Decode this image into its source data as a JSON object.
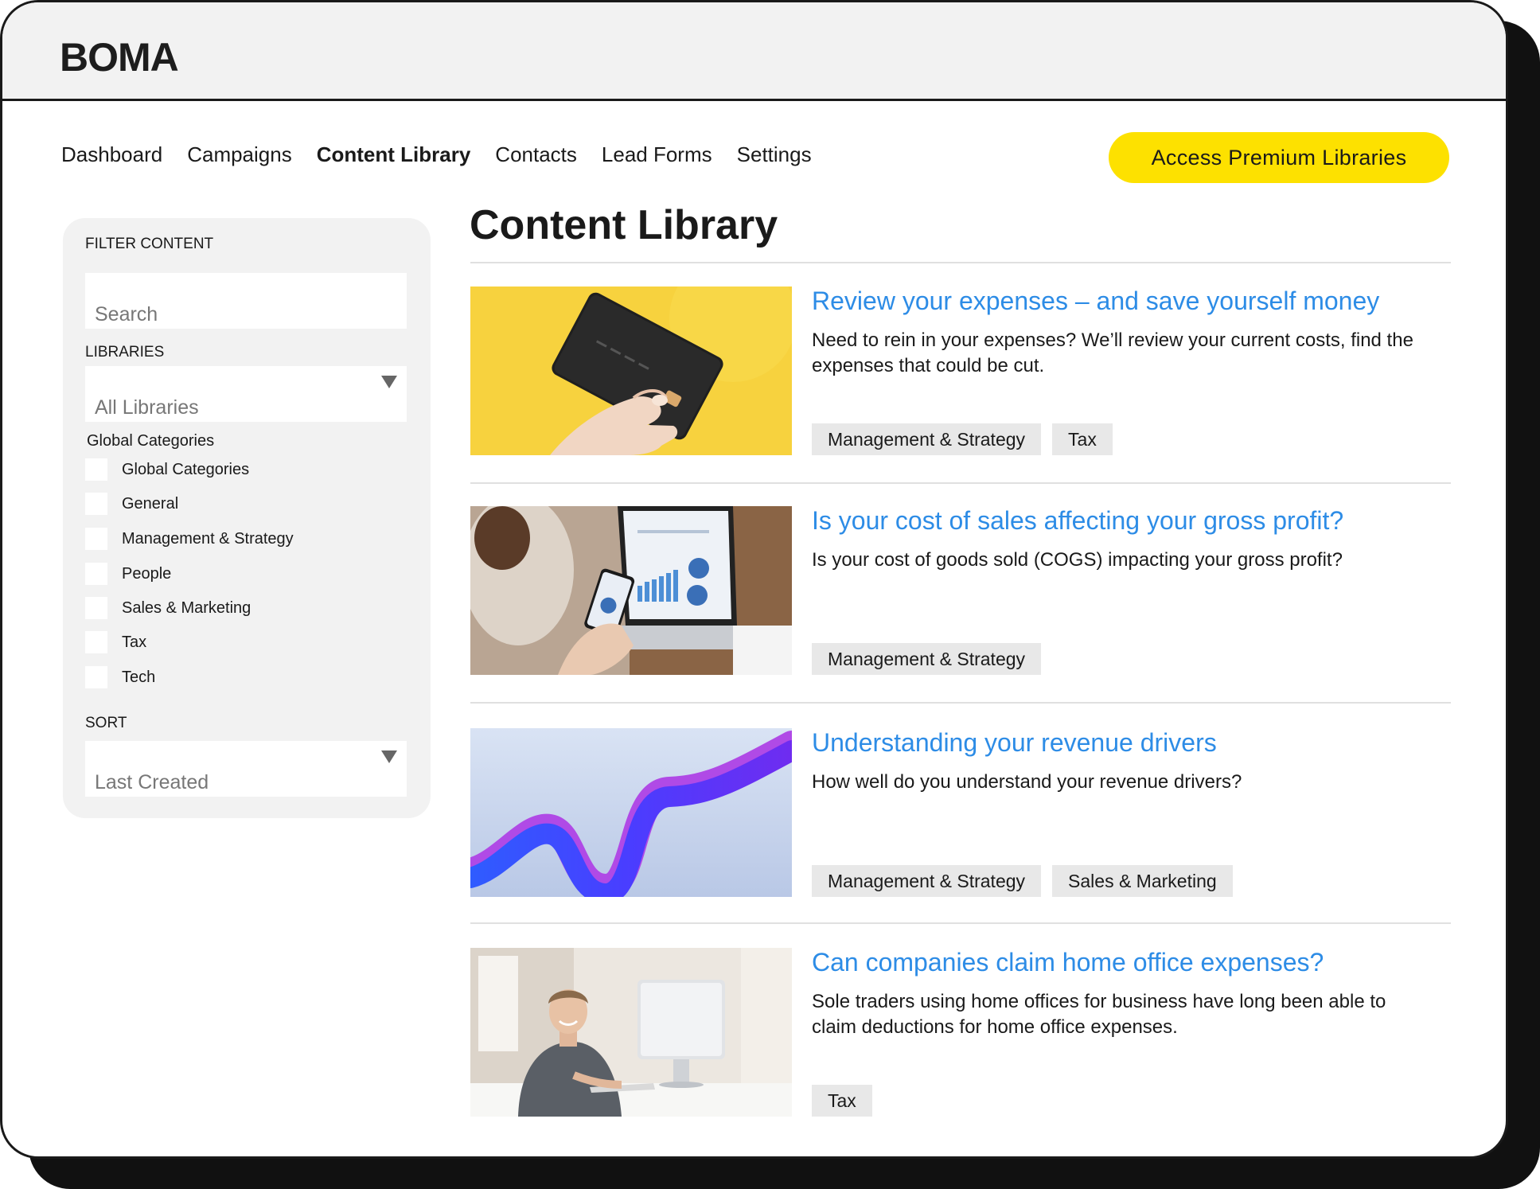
{
  "brand": {
    "logo": "BOMA"
  },
  "nav": {
    "items": [
      {
        "label": "Dashboard",
        "active": false
      },
      {
        "label": "Campaigns",
        "active": false
      },
      {
        "label": "Content Library",
        "active": true
      },
      {
        "label": "Contacts",
        "active": false
      },
      {
        "label": "Lead Forms",
        "active": false
      },
      {
        "label": "Settings",
        "active": false
      }
    ],
    "premium_button": "Access Premium Libraries"
  },
  "sidebar": {
    "filter_label": "FILTER CONTENT",
    "search_placeholder": "Search",
    "libraries_label": "LIBRARIES",
    "libraries_value": "All Libraries",
    "categories_heading": "Global Categories",
    "categories": [
      {
        "label": "Global Categories",
        "checked": false
      },
      {
        "label": "General",
        "checked": false
      },
      {
        "label": "Management & Strategy",
        "checked": false
      },
      {
        "label": "People",
        "checked": false
      },
      {
        "label": "Sales & Marketing",
        "checked": false
      },
      {
        "label": "Tax",
        "checked": false
      },
      {
        "label": "Tech",
        "checked": false
      }
    ],
    "sort_label": "SORT",
    "sort_value": "Last Created"
  },
  "main": {
    "title": "Content Library",
    "articles": [
      {
        "title": "Review your expenses – and save yourself money",
        "description": "Need to rein in your expenses? We’ll review your current costs, find the expenses that could be cut.",
        "tags": [
          "Management & Strategy",
          "Tax"
        ],
        "image": "credit-card-image"
      },
      {
        "title": "Is your cost of sales affecting your gross profit?",
        "description": "Is your cost of goods sold (COGS) impacting your gross profit?",
        "tags": [
          "Management & Strategy"
        ],
        "image": "laptop-charts-image"
      },
      {
        "title": "Understanding your revenue drivers",
        "description": "How well do you understand your revenue drivers?",
        "tags": [
          "Management & Strategy",
          "Sales & Marketing"
        ],
        "image": "wave-ribbon-image"
      },
      {
        "title": "Can companies claim home office expenses?",
        "description": "Sole traders using home offices for business have long been able to claim deductions for home office expenses.",
        "tags": [
          "Tax"
        ],
        "image": "home-office-image"
      }
    ]
  },
  "colors": {
    "accent_yellow": "#fde100",
    "link_blue": "#2d8ce6",
    "sidebar_bg": "#f2f2f2",
    "tag_bg": "#e8e8e8"
  }
}
